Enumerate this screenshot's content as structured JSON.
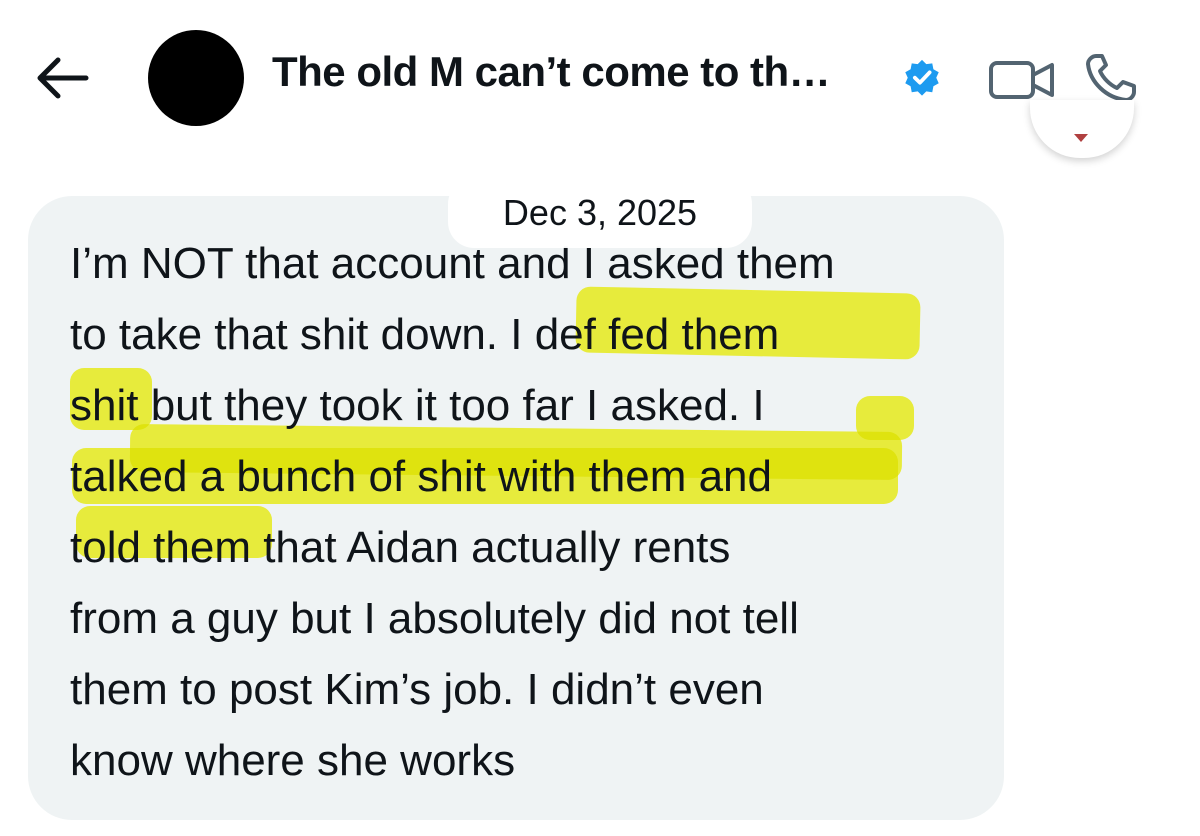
{
  "header": {
    "title": "The old M can’t come to th…",
    "verified": true,
    "accent_color": "#1d9bf0"
  },
  "icons": {
    "back": "arrow-left-icon",
    "avatar": "avatar",
    "verified": "verified-badge-icon",
    "video": "video-camera-icon",
    "call": "phone-icon",
    "scroll": "chevron-down-icon"
  },
  "conversation": {
    "date": "Dec 3, 2025",
    "message_lines": [
      "I’m NOT that account and I asked them",
      "to take that shit down. I def fed them",
      "shit but they took it too far I asked. I",
      "talked a bunch of shit with them and",
      "told them that Aidan actually rents",
      "from a guy but I absolutely did not tell",
      "them to post Kim’s job. I didn’t even",
      "know where she works"
    ],
    "highlight_color": "#f5f514"
  }
}
